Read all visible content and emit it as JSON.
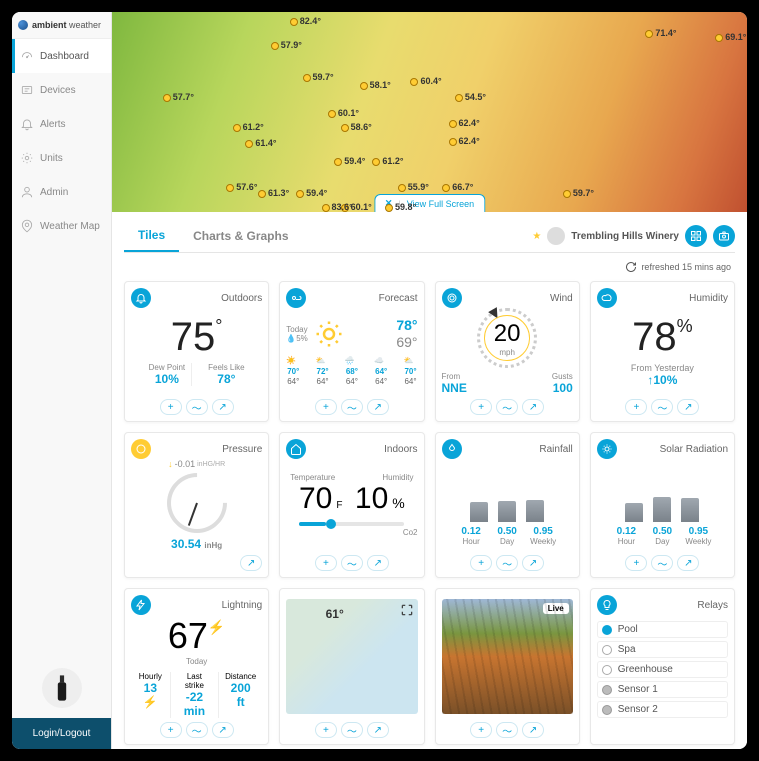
{
  "brand": {
    "bold": "ambient",
    "light": "weather"
  },
  "sidebar": {
    "items": [
      {
        "label": "Dashboard",
        "active": true
      },
      {
        "label": "Devices"
      },
      {
        "label": "Alerts"
      },
      {
        "label": "Units"
      },
      {
        "label": "Admin"
      },
      {
        "label": "Weather Map"
      }
    ],
    "login": "Login/Logout"
  },
  "map": {
    "view_full": "View Full Screen",
    "points": [
      {
        "t": "82.4°",
        "x": 28,
        "y": 2
      },
      {
        "t": "57.9°",
        "x": 25,
        "y": 14
      },
      {
        "t": "71.4°",
        "x": 84,
        "y": 8
      },
      {
        "t": "69.1°",
        "x": 95,
        "y": 10
      },
      {
        "t": "59.7°",
        "x": 30,
        "y": 30
      },
      {
        "t": "57.7°",
        "x": 8,
        "y": 40
      },
      {
        "t": "58.1°",
        "x": 39,
        "y": 34
      },
      {
        "t": "60.4°",
        "x": 47,
        "y": 32
      },
      {
        "t": "60.1°",
        "x": 34,
        "y": 48
      },
      {
        "t": "54.5°",
        "x": 54,
        "y": 40
      },
      {
        "t": "61.2°",
        "x": 19,
        "y": 55
      },
      {
        "t": "58.6°",
        "x": 36,
        "y": 55
      },
      {
        "t": "62.4°",
        "x": 53,
        "y": 53
      },
      {
        "t": "61.4°",
        "x": 21,
        "y": 63
      },
      {
        "t": "62.4°",
        "x": 53,
        "y": 62
      },
      {
        "t": "59.4°",
        "x": 35,
        "y": 72
      },
      {
        "t": "61.2°",
        "x": 41,
        "y": 72
      },
      {
        "t": "57.6°",
        "x": 18,
        "y": 85
      },
      {
        "t": "61.3°",
        "x": 23,
        "y": 88
      },
      {
        "t": "59.4°",
        "x": 29,
        "y": 88
      },
      {
        "t": "55.9°",
        "x": 45,
        "y": 85
      },
      {
        "t": "66.7°",
        "x": 52,
        "y": 85
      },
      {
        "t": "60.1°",
        "x": 36,
        "y": 95
      },
      {
        "t": "83.6°",
        "x": 33,
        "y": 95
      },
      {
        "t": "59.8°",
        "x": 43,
        "y": 95
      },
      {
        "t": "59.7°",
        "x": 71,
        "y": 88
      }
    ]
  },
  "tabs": {
    "tiles": "Tiles",
    "charts": "Charts & Graphs"
  },
  "location": {
    "name": "Trembling Hills Winery"
  },
  "refresh": {
    "text": "refreshed 15 mins ago"
  },
  "tiles": {
    "outdoors": {
      "title": "Outdoors",
      "value": "75",
      "dewpoint_label": "Dew Point",
      "dewpoint": "10%",
      "feels_label": "Feels Like",
      "feels": "78°"
    },
    "forecast": {
      "title": "Forecast",
      "today_label": "Today",
      "precip": "5%",
      "hi": "78°",
      "lo": "69°",
      "days": [
        {
          "hi": "70°",
          "lo": "64°"
        },
        {
          "hi": "72°",
          "lo": "64°"
        },
        {
          "hi": "68°",
          "lo": "64°"
        },
        {
          "hi": "64°",
          "lo": "64°"
        },
        {
          "hi": "70°",
          "lo": "64°"
        }
      ]
    },
    "wind": {
      "title": "Wind",
      "value": "20",
      "unit": "mph",
      "from_label": "From",
      "from": "NNE",
      "gusts_label": "Gusts",
      "gusts": "100"
    },
    "humidity": {
      "title": "Humidity",
      "value": "78",
      "sub_label": "From Yesterday",
      "delta": "↑10%"
    },
    "pressure": {
      "title": "Pressure",
      "delta": "-0.01",
      "delta_unit": "inHG/HR",
      "value": "30.54",
      "unit": "inHg"
    },
    "indoors": {
      "title": "Indoors",
      "temp_label": "Temperature",
      "temp": "70",
      "temp_unit": "F",
      "hum_label": "Humidity",
      "hum": "10",
      "co2_label": "Co2"
    },
    "rainfall": {
      "title": "Rainfall",
      "cols": [
        {
          "v": "0.12",
          "l": "Hour"
        },
        {
          "v": "0.50",
          "l": "Day"
        },
        {
          "v": "0.95",
          "l": "Weekly"
        }
      ]
    },
    "solar": {
      "title": "Solar Radiation",
      "cols": [
        {
          "v": "0.12",
          "l": "Hour"
        },
        {
          "v": "0.50",
          "l": "Day"
        },
        {
          "v": "0.95",
          "l": "Weekly"
        }
      ]
    },
    "lightning": {
      "title": "Lightning",
      "value": "67",
      "today": "Today",
      "cols": [
        {
          "l": "Hourly",
          "v": "13 ⚡"
        },
        {
          "l": "Last strike",
          "v": "-22 min"
        },
        {
          "l": "Distance",
          "v": "200 ft"
        }
      ]
    },
    "minimap": {
      "temp": "61°"
    },
    "cam": {
      "live": "Live"
    },
    "relays": {
      "title": "Relays",
      "items": [
        {
          "name": "Pool",
          "state": "on"
        },
        {
          "name": "Spa",
          "state": "off"
        },
        {
          "name": "Greenhouse",
          "state": "off"
        },
        {
          "name": "Sensor 1",
          "state": "gray"
        },
        {
          "name": "Sensor 2",
          "state": "gray"
        }
      ]
    }
  }
}
